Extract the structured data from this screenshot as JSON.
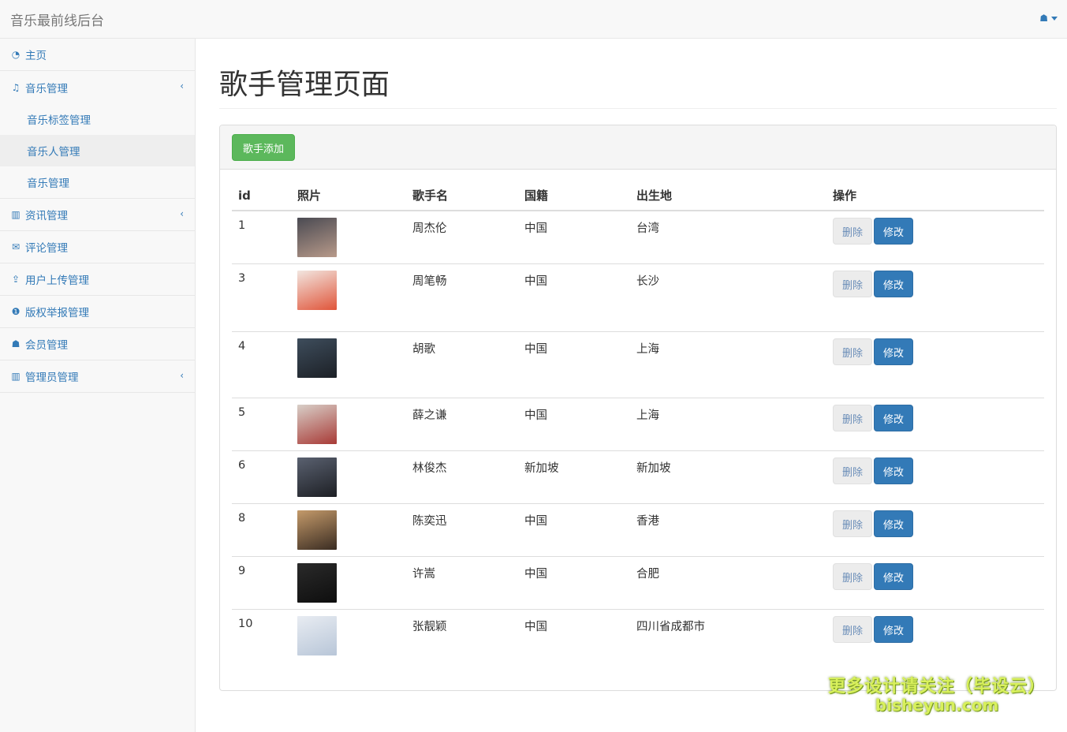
{
  "app": {
    "title": "音乐最前线后台"
  },
  "sidebar": {
    "items": [
      {
        "label": "主页",
        "icon": "dashboard-icon",
        "glyph": "◔"
      },
      {
        "label": "音乐管理",
        "icon": "music-icon",
        "glyph": "♫",
        "expanded": true,
        "children": [
          {
            "label": "音乐标签管理",
            "active": false
          },
          {
            "label": "音乐人管理",
            "active": true
          },
          {
            "label": "音乐管理",
            "active": false
          }
        ]
      },
      {
        "label": "资讯管理",
        "icon": "bar-chart-icon",
        "glyph": "▥",
        "has_arrow": true
      },
      {
        "label": "评论管理",
        "icon": "comments-icon",
        "glyph": "✉"
      },
      {
        "label": "用户上传管理",
        "icon": "upload-icon",
        "glyph": "⇪"
      },
      {
        "label": "版权举报管理",
        "icon": "info-circle-icon",
        "glyph": "❶"
      },
      {
        "label": "会员管理",
        "icon": "user-icon",
        "glyph": "☗"
      },
      {
        "label": "管理员管理",
        "icon": "bar-chart-icon",
        "glyph": "▥",
        "has_arrow": true
      }
    ]
  },
  "main": {
    "title": "歌手管理页面",
    "add_button": "歌手添加",
    "table": {
      "headers": [
        "id",
        "照片",
        "歌手名",
        "国籍",
        "出生地",
        "操作"
      ],
      "delete_label": "删除",
      "edit_label": "修改",
      "rows": [
        {
          "id": "1",
          "name": "周杰伦",
          "nationality": "中国",
          "birthplace": "台湾",
          "colors": [
            "#4a4a52",
            "#b89a8a"
          ]
        },
        {
          "id": "3",
          "name": "周笔畅",
          "nationality": "中国",
          "birthplace": "长沙",
          "colors": [
            "#f2e6e0",
            "#e0553a"
          ]
        },
        {
          "id": "4",
          "name": "胡歌",
          "nationality": "中国",
          "birthplace": "上海",
          "colors": [
            "#3e4d5c",
            "#1c2026"
          ]
        },
        {
          "id": "5",
          "name": "薛之谦",
          "nationality": "中国",
          "birthplace": "上海",
          "colors": [
            "#d8cfc8",
            "#a83a36"
          ]
        },
        {
          "id": "6",
          "name": "林俊杰",
          "nationality": "新加坡",
          "birthplace": "新加坡",
          "colors": [
            "#5a6170",
            "#1d1f24"
          ]
        },
        {
          "id": "8",
          "name": "陈奕迅",
          "nationality": "中国",
          "birthplace": "香港",
          "colors": [
            "#c49a6a",
            "#3a2c22"
          ]
        },
        {
          "id": "9",
          "name": "许嵩",
          "nationality": "中国",
          "birthplace": "合肥",
          "colors": [
            "#2a2a2a",
            "#0e0e0e"
          ]
        },
        {
          "id": "10",
          "name": "张靓颖",
          "nationality": "中国",
          "birthplace": "四川省成都市",
          "colors": [
            "#e8ecf2",
            "#b8c6d8"
          ]
        }
      ],
      "row_heights": [
        67,
        86,
        84,
        67,
        67,
        67,
        67,
        80
      ]
    }
  },
  "watermark": {
    "line1": "更多设计请关注（毕设云）",
    "line2": "bisheyun.com"
  },
  "colors": {
    "primary": "#337ab7",
    "success": "#5cb85c",
    "navbar_bg": "#f8f8f8"
  }
}
